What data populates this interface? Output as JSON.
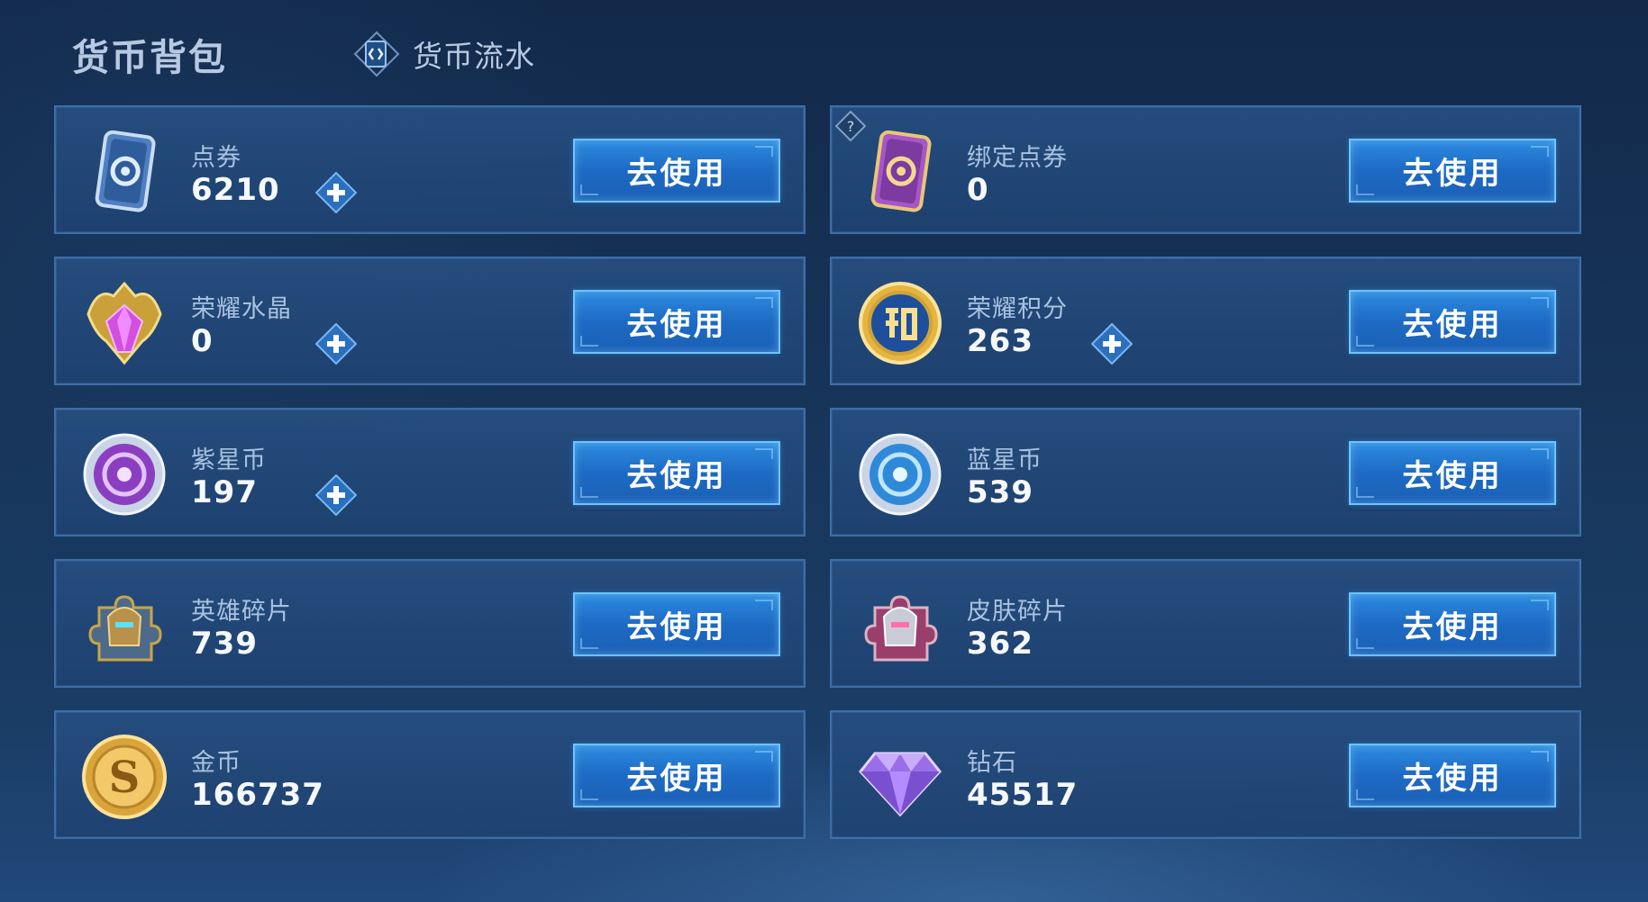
{
  "header": {
    "title": "货币背包",
    "flow_tab_label": "货币流水"
  },
  "use_label": "去使用",
  "cards": [
    {
      "name": "点券",
      "value": "6210",
      "icon": "voucher-card-icon",
      "has_plus": true
    },
    {
      "name": "绑定点券",
      "value": "0",
      "icon": "bound-voucher-card-icon",
      "has_help": true
    },
    {
      "name": "荣耀水晶",
      "value": "0",
      "icon": "glory-crystal-icon",
      "has_plus": true
    },
    {
      "name": "荣耀积分",
      "value": "263",
      "icon": "glory-points-icon",
      "has_plus": true
    },
    {
      "name": "紫星币",
      "value": "197",
      "icon": "purple-star-coin-icon",
      "has_plus": true
    },
    {
      "name": "蓝星币",
      "value": "539",
      "icon": "blue-star-coin-icon"
    },
    {
      "name": "英雄碎片",
      "value": "739",
      "icon": "hero-fragment-icon"
    },
    {
      "name": "皮肤碎片",
      "value": "362",
      "icon": "skin-fragment-icon"
    },
    {
      "name": "金币",
      "value": "166737",
      "icon": "gold-coin-icon"
    },
    {
      "name": "钻石",
      "value": "45517",
      "icon": "diamond-icon"
    }
  ],
  "colors": {
    "card_bg": "#244c80",
    "button": "#2378d2",
    "button_border": "#6cc4ff",
    "plus": "#2b6fbf",
    "title_text": "#b7c9e2"
  }
}
